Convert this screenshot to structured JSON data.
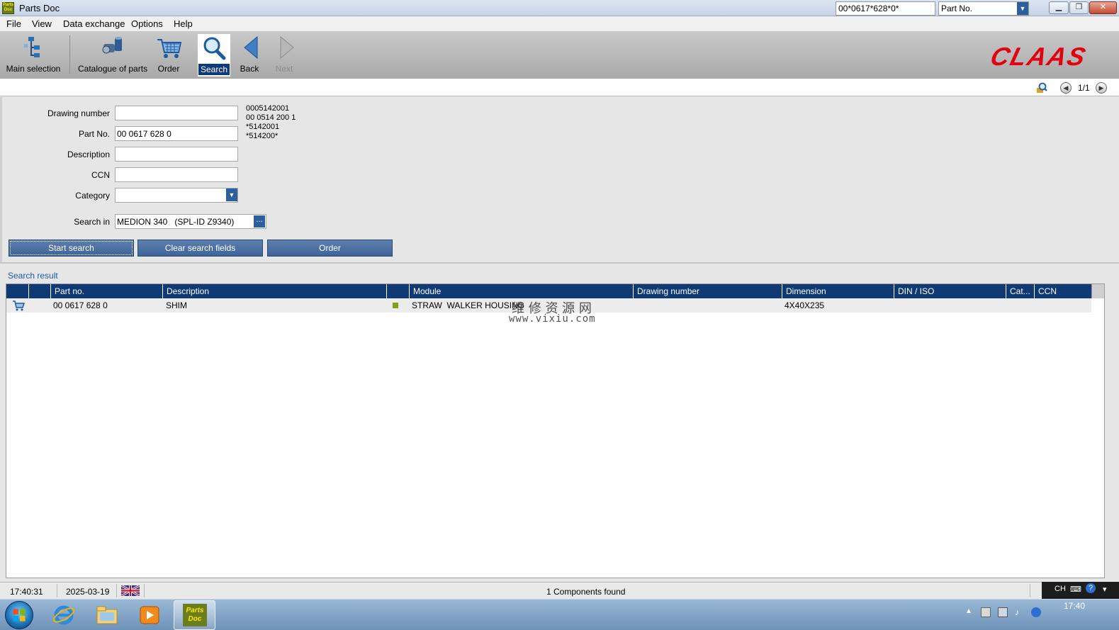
{
  "window": {
    "title": "Parts Doc",
    "app_icon_text": "Parts Doc"
  },
  "menu": {
    "items": [
      "File",
      "View",
      "Data exchange",
      "Options",
      "Help"
    ]
  },
  "toolbar": {
    "main_selection": "Main selection",
    "catalogue": "Catalogue of parts",
    "order": "Order",
    "search": "Search",
    "back": "Back",
    "next": "Next"
  },
  "brand": {
    "name": "CLAAS",
    "color": "#e3000f"
  },
  "quick_search": {
    "value": "00*0617*628*0*",
    "type_selected": "Part No.",
    "pager": "1/1"
  },
  "form": {
    "drawing_number_label": "Drawing number",
    "drawing_number_value": "",
    "part_no_label": "Part No.",
    "part_no_value": "00 0617 628 0",
    "description_label": "Description",
    "description_value": "",
    "ccn_label": "CCN",
    "ccn_value": "",
    "category_label": "Category",
    "category_value": "",
    "search_in_label": "Search in",
    "search_in_value": "MEDION 340   (SPL-ID Z9340)",
    "hints": [
      "0005142001",
      "00 0514 200 1",
      "*5142001",
      "*514200*"
    ],
    "start_search": "Start search",
    "clear_fields": "Clear search fields",
    "order": "Order"
  },
  "results": {
    "title": "Search result",
    "columns": [
      "",
      "",
      "Part no.",
      "Description",
      "",
      "Module",
      "Drawing number",
      "Dimension",
      "DIN / ISO",
      "Cat...",
      "CCN"
    ],
    "rows": [
      {
        "part_no": "00 0617 628 0",
        "description": "SHIM",
        "module": "STRAW  WALKER HOUSING",
        "drawing_number": "",
        "dimension": "4X40X235",
        "din_iso": "",
        "cat": "",
        "ccn": ""
      }
    ]
  },
  "watermark": {
    "line1": "维 修 资 源 网",
    "line2": "www.vixiu.com"
  },
  "status": {
    "time": "17:40:31",
    "date": "2025-03-19",
    "message": "1 Components found",
    "lang": "CH"
  },
  "taskbar": {
    "clock": "17:40"
  },
  "colors": {
    "header_blue": "#0f3a75",
    "button_blue": "#4a6fa3",
    "module_dot": "#7fa01f"
  }
}
